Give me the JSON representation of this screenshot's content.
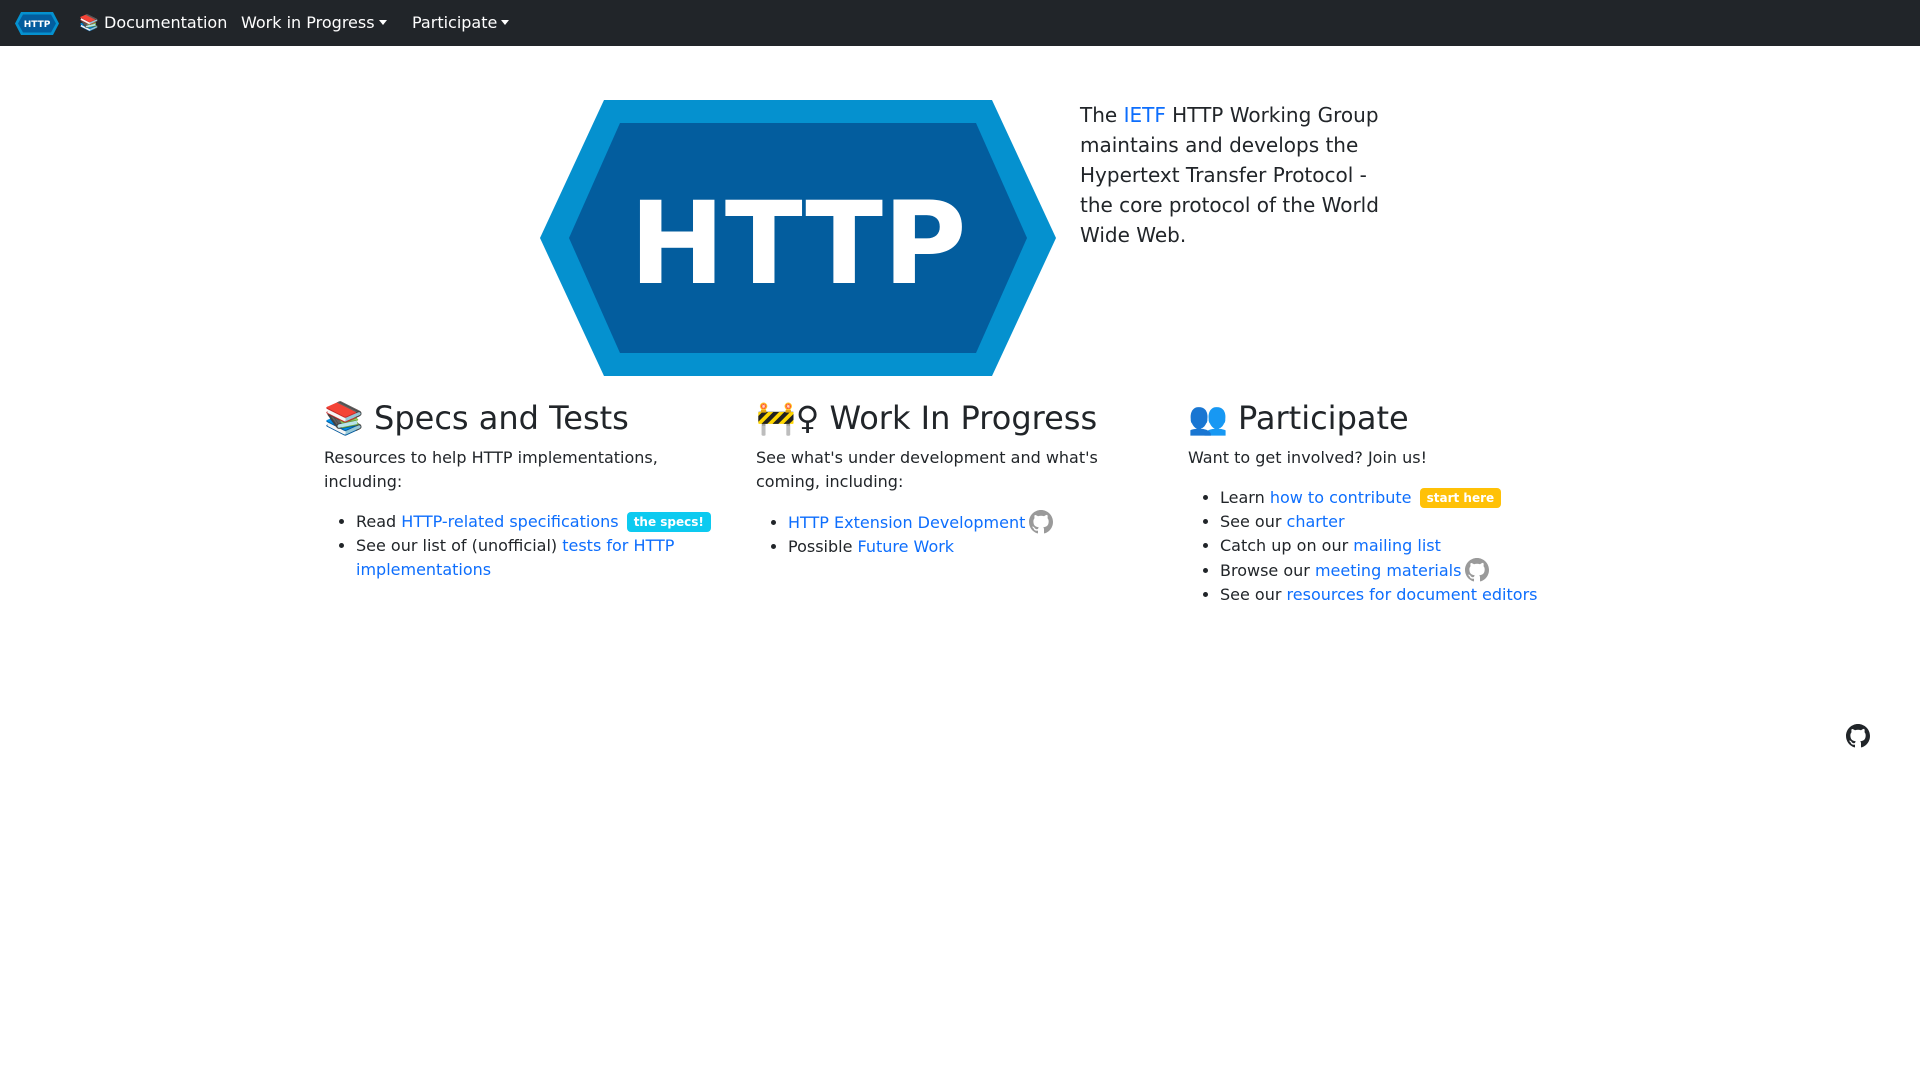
{
  "nav": {
    "logo_text": "HTTP",
    "documentation": "📚 Documentation",
    "work_in_progress": "Work in Progress",
    "participate": "Participate"
  },
  "hero": {
    "logo_text": "HTTP",
    "intro_before": "The ",
    "ietf_link": "IETF",
    "intro_after": " HTTP Working Group maintains and develops the Hypertext Transfer Protocol - the core protocol of the World Wide Web."
  },
  "specs": {
    "heading": "📚 Specs and Tests",
    "description": "Resources to help HTTP implementations, including:",
    "items": [
      {
        "prefix": "Read ",
        "link": "HTTP-related specifications",
        "badge": "the specs!"
      },
      {
        "prefix": "See our list of (unofficial) ",
        "link": "tests for HTTP implementations"
      }
    ]
  },
  "wip": {
    "heading": "🚧♀ Work In Progress",
    "description": "See what's under development and what's coming, including:",
    "items": [
      {
        "prefix": "",
        "link": "HTTP Extension Development",
        "icon": "github-icon"
      },
      {
        "prefix": "Possible ",
        "link": "Future Work"
      }
    ]
  },
  "participate": {
    "heading": "👥 Participate",
    "description": "Want to get involved? Join us!",
    "items": [
      {
        "prefix": "Learn ",
        "link": "how to contribute",
        "badge": "start here"
      },
      {
        "prefix": "See our ",
        "link": "charter"
      },
      {
        "prefix": "Catch up on our ",
        "link": "mailing list"
      },
      {
        "prefix": "Browse our ",
        "link": "meeting materials",
        "icon": "github-icon"
      },
      {
        "prefix": "See our ",
        "link": "resources for document editors"
      }
    ]
  },
  "colors": {
    "navbar": "#212529",
    "link": "#0d6efd",
    "logo_outer": "#0591cf",
    "logo_inner": "#035d9e",
    "badge_info": "#0dcaf0",
    "badge_warning": "#ffc107"
  }
}
